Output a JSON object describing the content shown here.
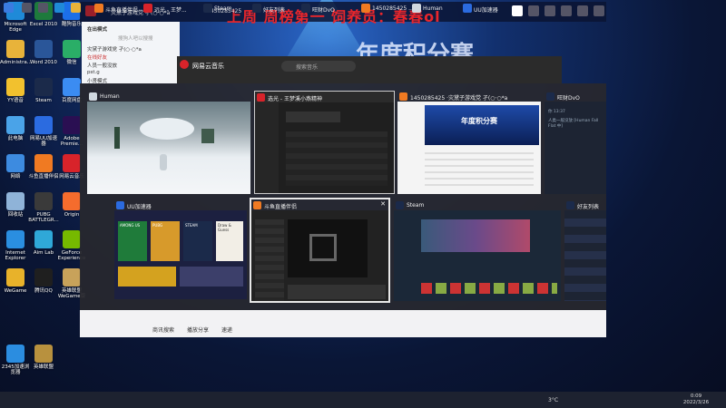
{
  "desktop": {
    "icons": [
      {
        "label": "Microsoft Edge",
        "icon": "edge-icon",
        "color": "#1f8ad8"
      },
      {
        "label": "Excel 2010",
        "icon": "excel-icon",
        "color": "#1e7a3c"
      },
      {
        "label": "酷狗音乐",
        "icon": "kugou-icon",
        "color": "#1c6fe8"
      },
      {
        "label": "Administra...",
        "icon": "folder-icon",
        "color": "#e8b33a"
      },
      {
        "label": "Word 2010",
        "icon": "word-icon",
        "color": "#2a5699"
      },
      {
        "label": "微信",
        "icon": "wechat-icon",
        "color": "#2aae67"
      },
      {
        "label": "YY语音",
        "icon": "yy-icon",
        "color": "#f2c12e"
      },
      {
        "label": "Steam",
        "icon": "steam-icon",
        "color": "#1b2a4a"
      },
      {
        "label": "百度网盘",
        "icon": "baidu-pan-icon",
        "color": "#3b8cf2"
      },
      {
        "label": "此电脑",
        "icon": "computer-icon",
        "color": "#4aa3e8"
      },
      {
        "label": "网易UU加速器",
        "icon": "uu-icon",
        "color": "#2b6be0"
      },
      {
        "label": "Adobe Premie...",
        "icon": "premiere-icon",
        "color": "#2a0f52"
      },
      {
        "label": "网络",
        "icon": "network-icon",
        "color": "#3d8be0"
      },
      {
        "label": "斗鱼直播伴侣",
        "icon": "douyu-icon",
        "color": "#f07a22"
      },
      {
        "label": "网易云音乐",
        "icon": "netease-icon",
        "color": "#d8232a"
      },
      {
        "label": "回收站",
        "icon": "recycle-bin-icon",
        "color": "#8fb3d8"
      },
      {
        "label": "PUBG BATTLEGR...",
        "icon": "pubg-icon",
        "color": "#3a3a3a"
      },
      {
        "label": "Origin",
        "icon": "origin-icon",
        "color": "#f56c2d"
      },
      {
        "label": "Internet Explorer",
        "icon": "ie-icon",
        "color": "#2a8ee0"
      },
      {
        "label": "Aim Lab",
        "icon": "aimlab-icon",
        "color": "#2fa8d8"
      },
      {
        "label": "GeForce Experience",
        "icon": "geforce-icon",
        "color": "#76b900"
      },
      {
        "label": "WeGame",
        "icon": "wegame-icon",
        "color": "#e8b22a"
      },
      {
        "label": "腾讯QQ",
        "icon": "qq-icon",
        "color": "#1f1f1f"
      },
      {
        "label": "英雄联盟WeGame版",
        "icon": "lol-wegame-icon",
        "color": "#c8a25a"
      },
      {
        "label": "2345加速浏览器",
        "icon": "browser-2345-icon",
        "color": "#2b8de0"
      },
      {
        "label": "英雄联盟",
        "icon": "lol-icon",
        "color": "#b8913e"
      }
    ]
  },
  "stream": {
    "title": "灾黛子游戏党 孑(○·○*a",
    "user_id": "1450285425",
    "slogan": "上周 周榜第一 饲养员：春春ol",
    "banner": "年度积分赛",
    "viewer_count": "5"
  },
  "chat_panel": {
    "header": "在出模式",
    "search_placeholder": "搜狗人吧以搜搜",
    "lines": [
      "灾黛子游戏党 孑(○·○*a",
      "在线好友",
      "人员一般没放",
      "pst.g",
      "小贤模式"
    ]
  },
  "music": {
    "app_name": "网易云音乐",
    "search_placeholder": "搜索音乐"
  },
  "task_view": {
    "windows": [
      {
        "title": "Human",
        "icon": "human-fall-flat-icon",
        "color": "#d0d8e0"
      },
      {
        "title": "选光 - 王梦溪小燕精神",
        "icon": "netease-icon",
        "color": "#d8232a"
      },
      {
        "title": "1450285425 ·灾黛子游戏党 孑(○·○*a",
        "icon": "douyu-icon",
        "color": "#f07a22"
      },
      {
        "title": "旺财DvO",
        "icon": "steam-icon",
        "color": "#1b2a4a"
      },
      {
        "title": "UU加速器",
        "icon": "uu-icon",
        "color": "#2b6be0"
      },
      {
        "title": "斗鱼直播伴侣",
        "icon": "douyu-icon",
        "color": "#f07a22"
      },
      {
        "title": "Steam",
        "icon": "steam-icon",
        "color": "#1b2a4a"
      },
      {
        "title": "好友列表",
        "icon": "steam-icon",
        "color": "#1b2a4a"
      }
    ],
    "music_thumb_song": "年度积分赛",
    "chat_bubbles": [
      "你 13:37",
      "人类一般没放 [Human Fall Flat 中]"
    ],
    "uu_games": [
      "AMONG US",
      "PUBG",
      "STEAM",
      "Draw & Guess"
    ]
  },
  "bottom_bar": {
    "items": [
      "商讯搜索",
      "播放分享",
      "速递"
    ]
  },
  "taskbar": {
    "tasks": [
      {
        "label": "斗鱼直播伴侣",
        "icon": "douyu-icon",
        "color": "#f07a22"
      },
      {
        "label": "远光 - 王梦...",
        "icon": "netease-icon",
        "color": "#d8232a"
      },
      {
        "label": "Steam",
        "icon": "steam-icon",
        "color": "#1b2a4a"
      },
      {
        "label": "好友列表",
        "icon": "steam-icon",
        "color": "#1b2a4a"
      },
      {
        "label": "旺财DvO",
        "icon": "steam-icon",
        "color": "#1b2a4a"
      },
      {
        "label": "1450285425 ...",
        "icon": "douyu-icon",
        "color": "#f07a22"
      },
      {
        "label": "Human",
        "icon": "human-fall-flat-icon",
        "color": "#d0d8e0"
      },
      {
        "label": "UU加速器",
        "icon": "uu-icon",
        "color": "#2b6be0"
      }
    ],
    "temperature": "3°C",
    "time": "0:09",
    "date": "2022/3/26"
  }
}
